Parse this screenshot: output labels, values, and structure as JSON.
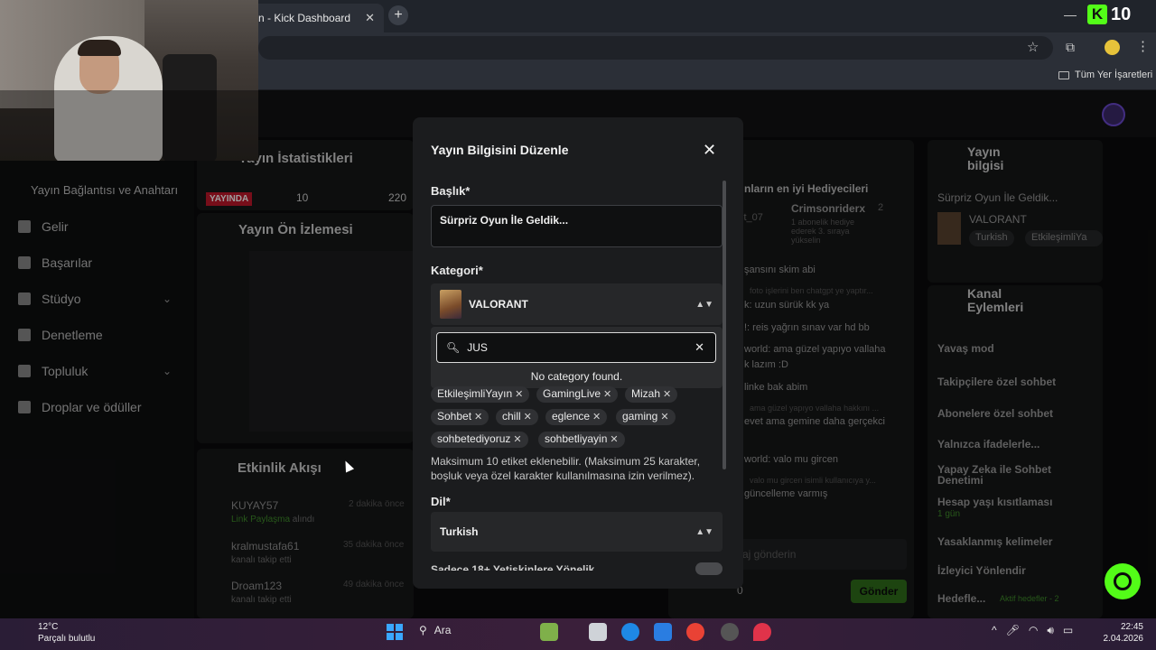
{
  "browser": {
    "tab_title": "n - Kick Dashboard",
    "bookmarks_all": "Tüm Yer İşaretleri",
    "badge_count": "10"
  },
  "sidebar": {
    "connection": "Yayın Bağlantısı ve Anahtarı",
    "items": [
      {
        "label": "Gelir",
        "icon": "chart-icon"
      },
      {
        "label": "Başarılar",
        "icon": "trophy-icon"
      },
      {
        "label": "Stüdyo",
        "icon": "studio-icon"
      },
      {
        "label": "Denetleme",
        "icon": "wrench-icon"
      },
      {
        "label": "Topluluk",
        "icon": "community-icon"
      },
      {
        "label": "Droplar ve ödüller",
        "icon": "drops-icon"
      }
    ]
  },
  "stats": {
    "title": "Yayın İstatistikleri",
    "live_badge": "YAYINDA",
    "v1": "10",
    "v2": "220"
  },
  "preview": {
    "title": "Yayın Ön İzlemesi"
  },
  "activity": {
    "title": "Etkinlik Akışı",
    "items": [
      {
        "user": "KUYAY57",
        "desc": "Link Paylaşma",
        "desc_suffix": " alındı",
        "time": "2 dakika önce"
      },
      {
        "user": "kralmustafa61",
        "desc": "kanalı takip etti",
        "desc_suffix": "",
        "time": "35 dakika önce"
      },
      {
        "user": "Droam123",
        "desc": "kanalı takip etti",
        "desc_suffix": "",
        "time": "49 dakika önce"
      }
    ]
  },
  "gifters": {
    "title": "nların en iyi Hediyecileri",
    "user": "Crimsonriderx",
    "count": "2",
    "detail": "1 abonelik hediye ederek 3. sıraya yükselin",
    "left_user": "st_07"
  },
  "chat": {
    "messages": [
      "şansını skim abi",
      "foto işlerini ben chatgpt ye yaptır...",
      "k: uzun sürük kk ya",
      "!: reis yağrın sınav var hd bb",
      "world: ama güzel yapıyo vallaha",
      "k lazım :D",
      "linke bak abim",
      "ama güzel yapıyo vallaha hakkını ...",
      "evet ama gemine daha gerçekci",
      "world: valo mu gircen",
      "valo mu gircen isimli kullanıcıya y...",
      "güncelleme varmış"
    ],
    "input_placeholder": "aj gönderin",
    "send": "Gönder",
    "points": "0"
  },
  "stream_info": {
    "title": "Yayın bilgisi",
    "stream_title": "Sürpriz Oyun İle Geldik...",
    "category": "VALORANT",
    "tags": [
      "Turkish",
      "EtkileşimliYa"
    ]
  },
  "channel_actions": {
    "title": "Kanal Eylemleri",
    "items": [
      "Yavaş mod",
      "Takipçilere özel sohbet",
      "Abonelere özel sohbet",
      "Yalnızca ifadelerle...",
      "Yapay Zeka ile Sohbet Denetimi",
      "Hesap yaşı kısıtlaması",
      "Yasaklanmış kelimeler",
      "İzleyici Yönlendir",
      "Hedefle..."
    ],
    "account_age_sub": "1 gün",
    "goals_sub": "Aktif hedefler - 2"
  },
  "modal": {
    "title": "Yayın Bilgisini Düzenle",
    "title_label": "Başlık*",
    "title_value": "Sürpriz Oyun İle Geldik...",
    "category_label": "Kategori*",
    "category_value": "VALORANT",
    "search_value": "JUS",
    "no_category": "No category found.",
    "tags": [
      "EtkileşimliYayın",
      "GamingLive",
      "Mizah",
      "Sohbet",
      "chill",
      "eglence",
      "gaming",
      "sohbetediyoruz",
      "sohbetliyayin"
    ],
    "tags_hint": "Maksimum 10 etiket eklenebilir. (Maksimum 25 karakter, boşluk veya özel karakter kullanılmasına izin verilmez).",
    "lang_label": "Dil*",
    "lang_value": "Turkish",
    "adult_label": "Sadece 18+ Yetişkinlere Yönelik"
  },
  "taskbar": {
    "weather_temp": "12°C",
    "weather_desc": "Parçalı bulutlu",
    "search": "Ara",
    "time": "22:45",
    "date": "2.04.2026"
  }
}
